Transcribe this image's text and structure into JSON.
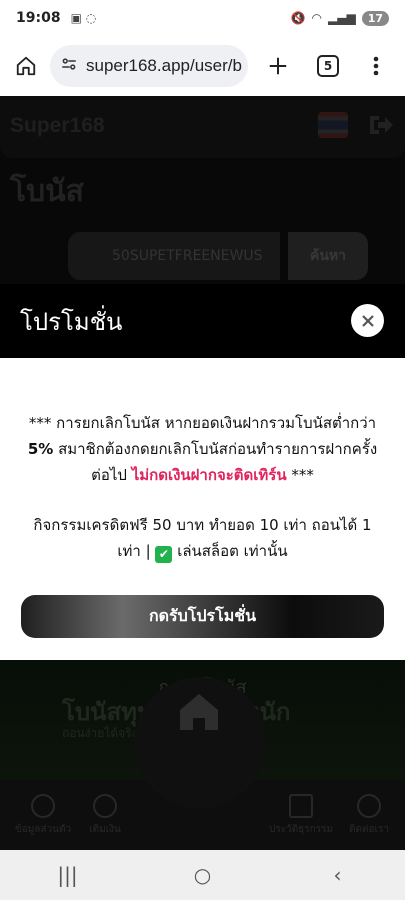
{
  "status_bar": {
    "time": "19:08",
    "battery": "17"
  },
  "browser": {
    "url": "super168.app/user/b",
    "tab_count": "5"
  },
  "site": {
    "logo": "Super168",
    "page_title": "โบนัส",
    "code_value": "50SUPETFREENEWUS",
    "search_label": "ค้นหา"
  },
  "banner": {
    "top_text": "กดรับโบนัส",
    "headline": "โบนัสทุนน้อยถอนหนัก",
    "subtext": "ถอนง่ายได้จริง ลีนจ่ายได้เลย"
  },
  "bottom_nav": {
    "items": [
      "ข้อมูลส่วนตัว",
      "เติมเงิน",
      "ประวัติธุรกรรม",
      "ติดต่อเรา"
    ]
  },
  "modal": {
    "title": "โปรโมชั่น",
    "notice_prefix": "*** การยกเลิกโบนัส หากยอดเงินฝากรวมโบนัสต่ำกว่า ",
    "notice_percent": "5%",
    "notice_mid": " สมาชิกต้องกดยกเลิกโบนัสก่อนทำรายการฝากครั้งต่อไป ",
    "notice_warning": "ไม่กดเงินฝากจะติดเทิร์น",
    "notice_suffix": " ***",
    "activity_text": "กิจกรรมเครดิตฟรี 50 บาท ทำยอด 10 เท่า ถอนได้ 1 เท่า | ",
    "activity_tail": " เล่นสล็อต เท่านั้น",
    "claim_button": "กดรับโปรโมชั่น"
  },
  "icons": {
    "home": "home-icon",
    "tune": "site-settings-icon",
    "plus": "new-tab-icon",
    "menu": "more-vert-icon",
    "close": "close-icon",
    "check": "check-mark-icon"
  }
}
